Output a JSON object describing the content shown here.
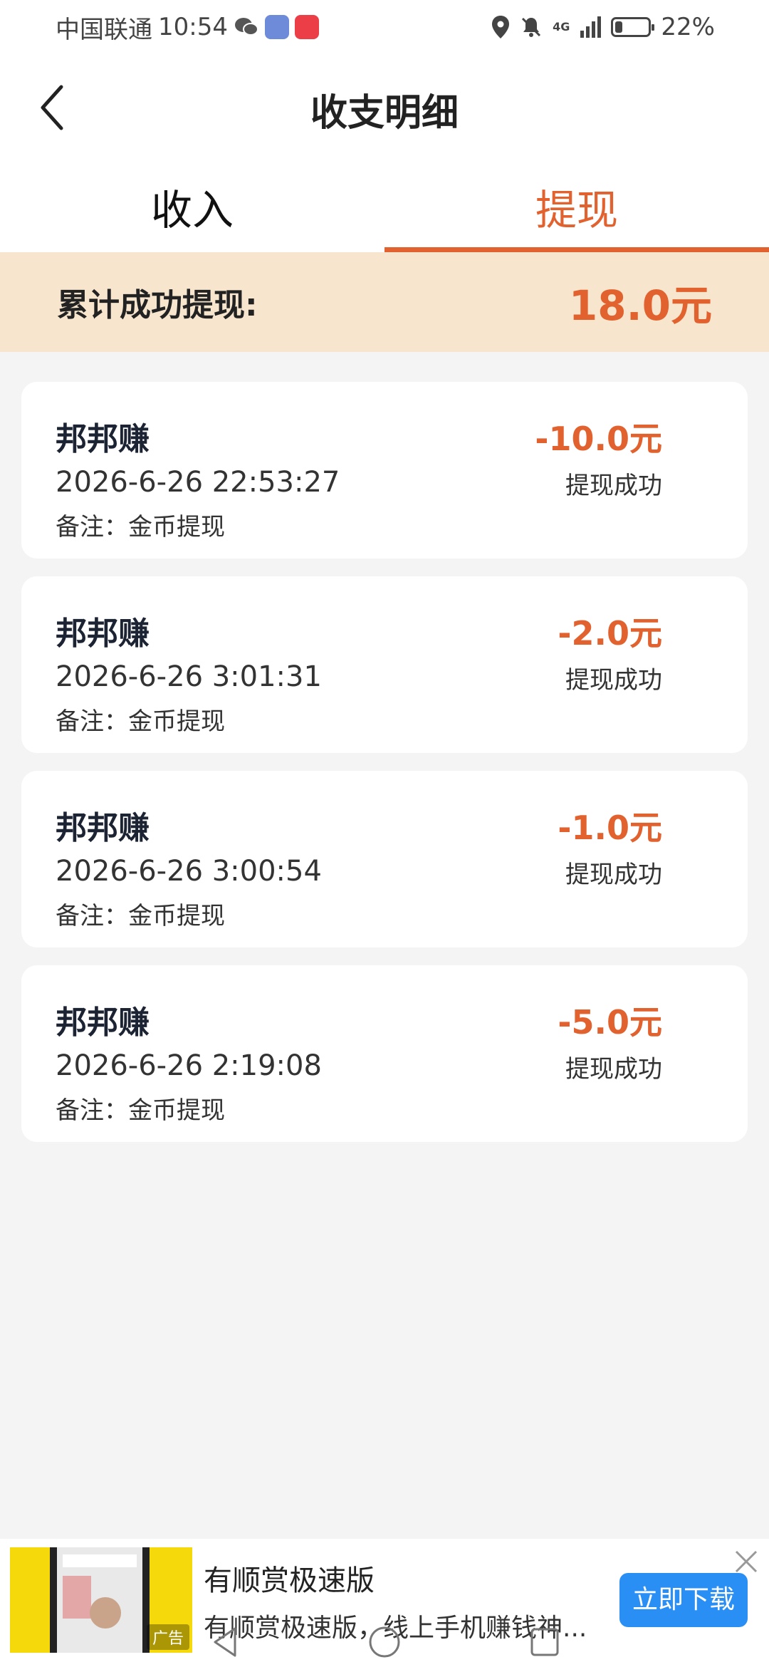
{
  "status_bar": {
    "carrier": "中国联通",
    "time": "10:54",
    "network": "4G",
    "battery_percent": "22%",
    "battery_level": 0.22
  },
  "header": {
    "title": "收支明细",
    "back_icon": "chevron-left-icon"
  },
  "tabs": [
    {
      "label": "收入",
      "active": false
    },
    {
      "label": "提现",
      "active": true
    }
  ],
  "summary": {
    "label": "累计成功提现:",
    "value": "18.0元"
  },
  "records": [
    {
      "name": "邦邦赚",
      "time": "2026-6-26 22:53:27",
      "note": "备注：金币提现",
      "amount": "-10.0元",
      "status": "提现成功"
    },
    {
      "name": "邦邦赚",
      "time": "2026-6-26 3:01:31",
      "note": "备注：金币提现",
      "amount": "-2.0元",
      "status": "提现成功"
    },
    {
      "name": "邦邦赚",
      "time": "2026-6-26 3:00:54",
      "note": "备注：金币提现",
      "amount": "-1.0元",
      "status": "提现成功"
    },
    {
      "name": "邦邦赚",
      "time": "2026-6-26 2:19:08",
      "note": "备注：金币提现",
      "amount": "-5.0元",
      "status": "提现成功"
    }
  ],
  "ad": {
    "title": "有顺赏极速版",
    "description": "有顺赏极速版，线上手机赚钱神...",
    "button_label": "立即下载",
    "tag": "广告"
  },
  "colors": {
    "accent": "#e2622f",
    "summary_bg": "#f7e6cd",
    "ad_button": "#2a8ff5"
  }
}
